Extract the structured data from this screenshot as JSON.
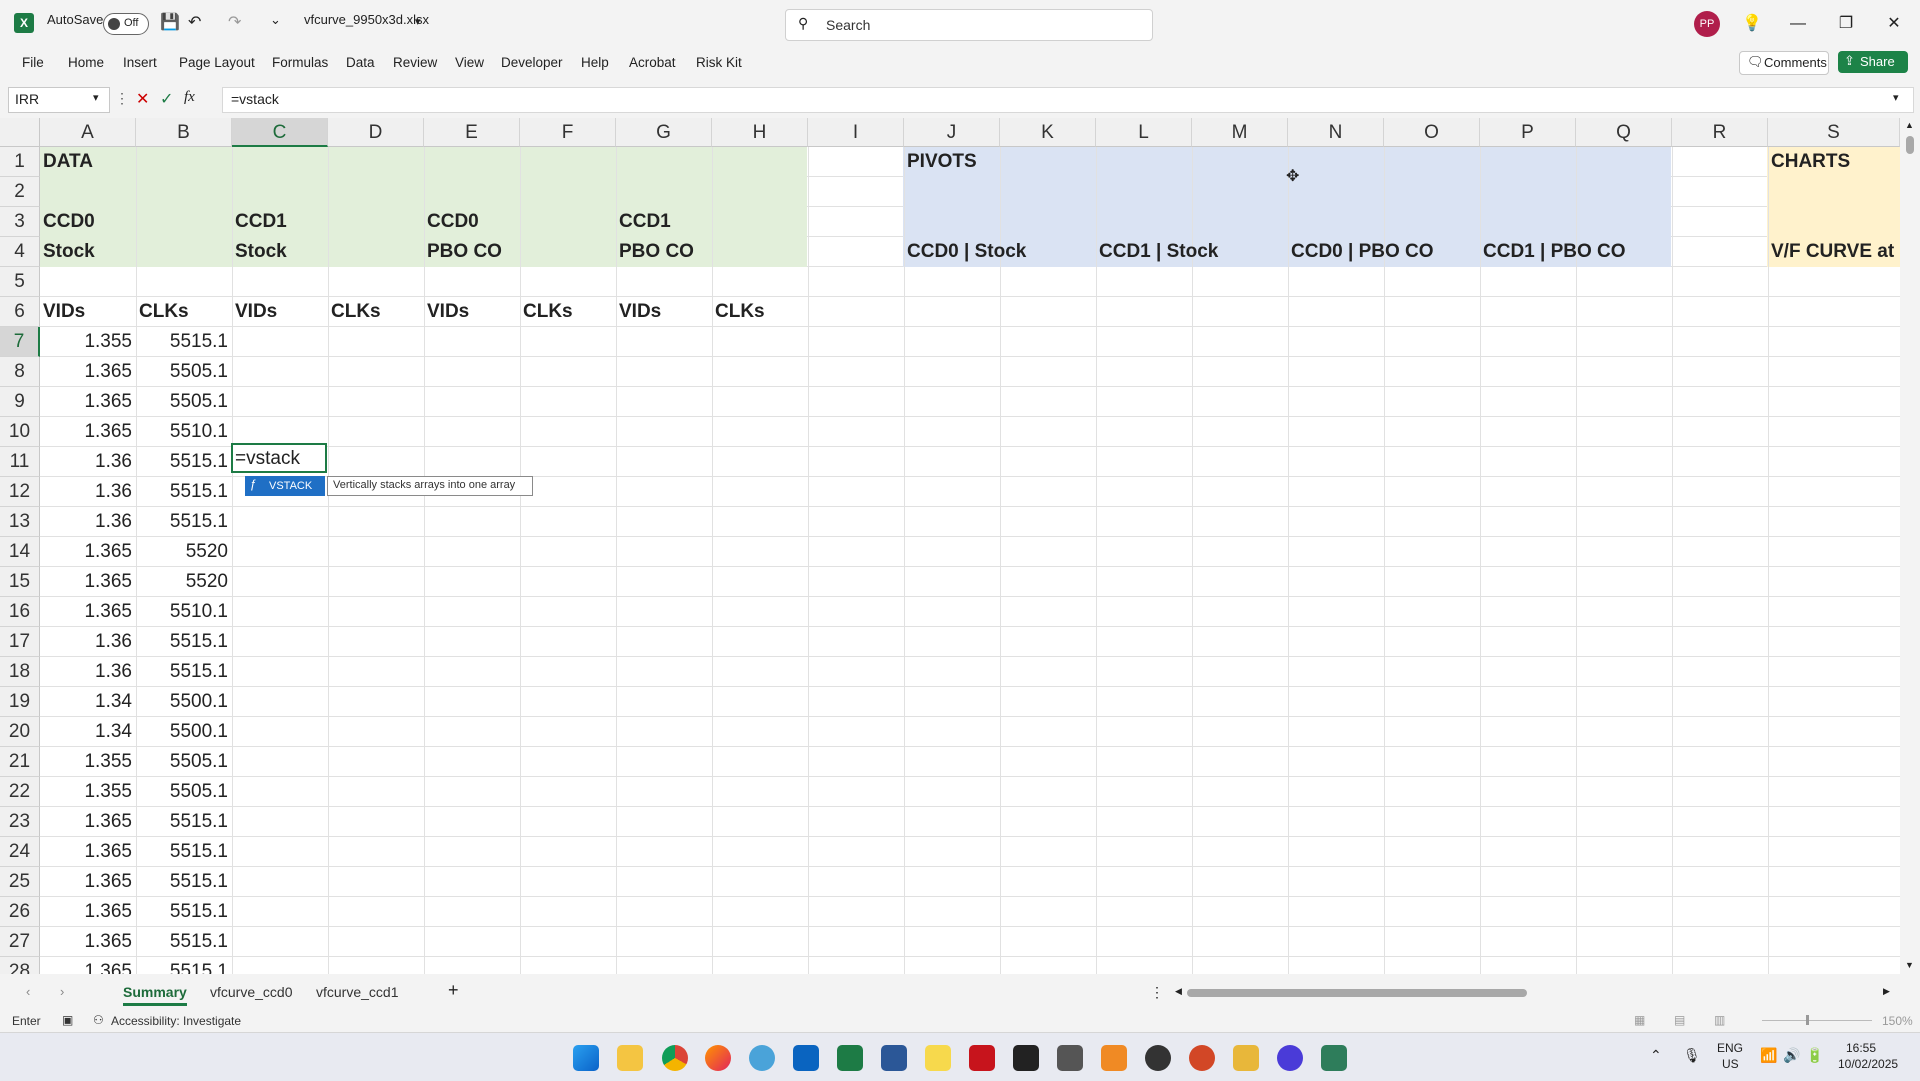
{
  "titlebar": {
    "autosave_label": "AutoSave",
    "autosave_state": "Off",
    "filename": "vfcurve_9950x3d.xlsx",
    "search_placeholder": "Search",
    "avatar_initials": "PP"
  },
  "ribbon": {
    "tabs": [
      "File",
      "Home",
      "Insert",
      "Page Layout",
      "Formulas",
      "Data",
      "Review",
      "View",
      "Developer",
      "Help",
      "Acrobat",
      "Risk Kit"
    ],
    "comments_label": "Comments",
    "share_label": "Share"
  },
  "formula_bar": {
    "name_box": "IRR",
    "fx_label": "fx",
    "formula": "=vstack"
  },
  "grid": {
    "columns": [
      "A",
      "B",
      "C",
      "D",
      "E",
      "F",
      "G",
      "H",
      "I",
      "J",
      "K",
      "L",
      "M",
      "N",
      "O",
      "P",
      "Q",
      "R",
      "S"
    ],
    "selected_column": "C",
    "rows": [
      "1",
      "2",
      "3",
      "4",
      "5",
      "6",
      "7",
      "8",
      "9",
      "10",
      "11",
      "12",
      "13",
      "14",
      "15",
      "16",
      "17",
      "18",
      "19",
      "20",
      "21",
      "22",
      "23",
      "24",
      "25",
      "26",
      "27",
      "28"
    ],
    "selected_row": "7",
    "headers": {
      "data": "DATA",
      "ccd0_stock_1": "CCD0",
      "ccd0_stock_2": "Stock",
      "ccd1_stock_1": "CCD1",
      "ccd1_stock_2": "Stock",
      "ccd0_pbo_1": "CCD0",
      "ccd0_pbo_2": "PBO CO",
      "ccd1_pbo_1": "CCD1",
      "ccd1_pbo_2": "PBO CO",
      "vids": "VIDs",
      "clks": "CLKs",
      "pivots": "PIVOTS",
      "pivot1": "CCD0 | Stock",
      "pivot2": "CCD1 | Stock",
      "pivot3": "CCD0 | PBO CO",
      "pivot4": "CCD1 | PBO CO",
      "charts": "CHARTS",
      "vf_curve": "V/F CURVE at"
    },
    "vids_values": [
      "1.355",
      "1.365",
      "1.365",
      "1.365",
      "1.36",
      "1.36",
      "1.36",
      "1.365",
      "1.365",
      "1.365",
      "1.36",
      "1.36",
      "1.34",
      "1.34",
      "1.355",
      "1.355",
      "1.365",
      "1.365",
      "1.365",
      "1.365",
      "1.365",
      "1.365"
    ],
    "clks_values": [
      "5515.1",
      "5505.1",
      "5505.1",
      "5510.1",
      "5515.1",
      "5515.1",
      "5515.1",
      "5520",
      "5520",
      "5510.1",
      "5515.1",
      "5515.1",
      "5500.1",
      "5500.1",
      "5505.1",
      "5505.1",
      "5515.1",
      "5515.1",
      "5515.1",
      "5515.1",
      "5515.1",
      "5515.1"
    ],
    "active_cell_text": "=vstack",
    "autocomplete_item": "VSTACK",
    "autocomplete_tooltip": "Vertically stacks arrays into one array",
    "colors": {
      "data_fill": "#e2efda",
      "pivots_fill": "#dae3f3",
      "charts_fill": "#fff2cc",
      "accent": "#1d7b45"
    }
  },
  "sheet_tabs": [
    "Summary",
    "vfcurve_ccd0",
    "vfcurve_ccd1"
  ],
  "active_sheet": "Summary",
  "statusbar": {
    "mode": "Enter",
    "accessibility": "Accessibility: Investigate",
    "zoom": "150%"
  },
  "taskbar": {
    "lang1": "ENG",
    "lang2": "US",
    "time": "16:55",
    "date": "10/02/2025"
  }
}
